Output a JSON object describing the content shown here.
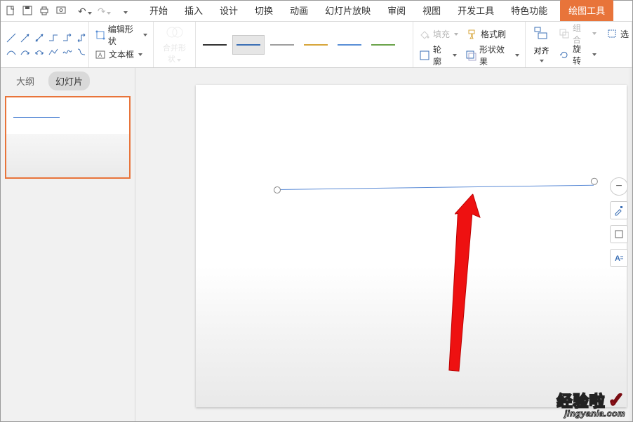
{
  "qat": {
    "undo": "↶",
    "redo": "↷"
  },
  "tabs": {
    "start": "开始",
    "insert": "插入",
    "design": "设计",
    "transition": "切换",
    "animation": "动画",
    "slideshow": "幻灯片放映",
    "review": "审阅",
    "view": "视图",
    "dev": "开发工具",
    "special": "特色功能",
    "context": "绘图工具"
  },
  "sidebar": {
    "outline": "大纲",
    "slides": "幻灯片"
  },
  "ribbon": {
    "edit_shape": "编辑形状",
    "textbox": "文本框",
    "merge": "合并形状",
    "fill": "填充",
    "outline": "轮廓",
    "format_painter": "格式刷",
    "shape_fx": "形状效果",
    "align": "对齐",
    "group": "组合",
    "rotate": "旋转",
    "select": "选"
  },
  "styles": {
    "colors": [
      "#333333",
      "#3b6fb5",
      "#9e9e9e",
      "#d7a53a",
      "#5a8fd6",
      "#6aa34a"
    ]
  },
  "floaters": {
    "minus": "−"
  },
  "watermark": {
    "line1": "经验啦",
    "check": "✓",
    "line2": "jingyanla.com"
  }
}
